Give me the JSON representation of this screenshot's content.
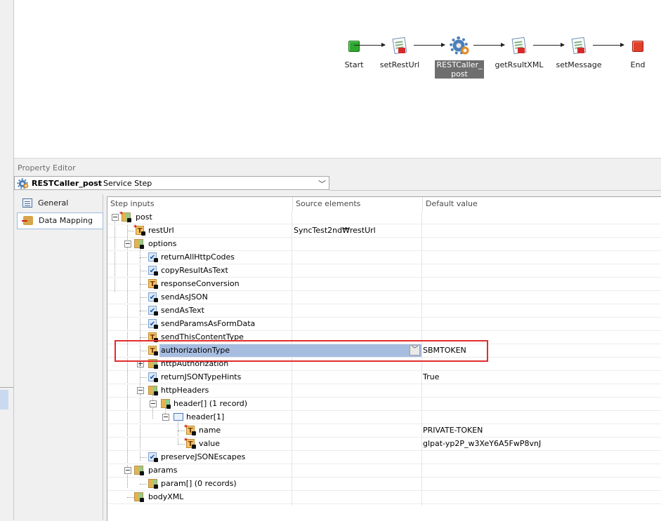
{
  "workflow": {
    "nodes": [
      {
        "label": "Start"
      },
      {
        "label": "setRestUrl"
      },
      {
        "label": "RESTCaller_\npost"
      },
      {
        "label": "getRsultXML"
      },
      {
        "label": "setMessage"
      },
      {
        "label": "End"
      }
    ]
  },
  "property_editor": {
    "title": "Property Editor",
    "step_name": "RESTCaller_post",
    "step_type": "Service Step",
    "tabs": [
      {
        "label": "General"
      },
      {
        "label": "Data Mapping"
      }
    ]
  },
  "grid": {
    "headers": {
      "step_inputs": "Step inputs",
      "source_elements": "Source elements",
      "default_value": "Default value"
    },
    "rows": [
      {
        "name": "post",
        "source": "",
        "default": ""
      },
      {
        "name": "restUrl",
        "source": "SyncTest2nd₩restUrl",
        "default": ""
      },
      {
        "name": "options",
        "source": "",
        "default": ""
      },
      {
        "name": "returnAllHttpCodes",
        "source": "",
        "default": ""
      },
      {
        "name": "copyResultAsText",
        "source": "",
        "default": ""
      },
      {
        "name": "responseConversion",
        "source": "",
        "default": ""
      },
      {
        "name": "sendAsJSON",
        "source": "",
        "default": ""
      },
      {
        "name": "sendAsText",
        "source": "",
        "default": ""
      },
      {
        "name": "sendParamsAsFormData",
        "source": "",
        "default": ""
      },
      {
        "name": "sendThisContentType",
        "source": "",
        "default": ""
      },
      {
        "name": "authorizationType",
        "source": "",
        "default": "SBMTOKEN"
      },
      {
        "name": "httpAuthorization",
        "source": "",
        "default": ""
      },
      {
        "name": "returnJSONTypeHints",
        "source": "",
        "default": "True"
      },
      {
        "name": "httpHeaders",
        "source": "",
        "default": ""
      },
      {
        "name": "header[] (1 record)",
        "source": "",
        "default": ""
      },
      {
        "name": "header[1]",
        "source": "",
        "default": ""
      },
      {
        "name": "name",
        "source": "",
        "default": "PRIVATE-TOKEN"
      },
      {
        "name": "value",
        "source": "",
        "default": "glpat-yp2P_w3XeY6A5FwP8vnJ"
      },
      {
        "name": "preserveJSONEscapes",
        "source": "",
        "default": ""
      },
      {
        "name": "params",
        "source": "",
        "default": ""
      },
      {
        "name": "param[] (0 records)",
        "source": "",
        "default": ""
      },
      {
        "name": "bodyXML",
        "source": "",
        "default": ""
      }
    ]
  }
}
